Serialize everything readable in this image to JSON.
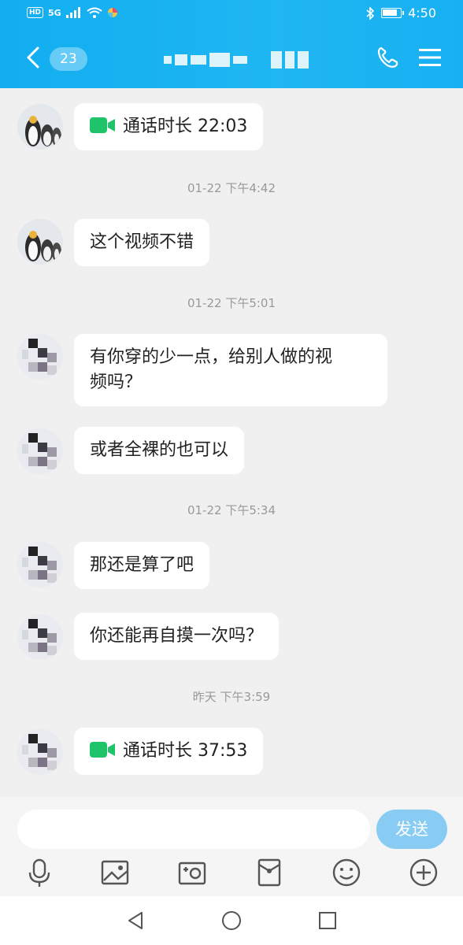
{
  "status_bar": {
    "hd_label": "HD",
    "network_label": "5G",
    "time": "4:50"
  },
  "header": {
    "unread_count": "23"
  },
  "timestamps": [
    "01-22 下午4:42",
    "01-22 下午5:01",
    "01-22 下午5:34",
    "昨天 下午3:59"
  ],
  "messages": [
    {
      "text": "通话时长 22:03",
      "type": "call",
      "avatar": "penguin"
    },
    {
      "text": "这个视频不错",
      "type": "text",
      "avatar": "penguin"
    },
    {
      "text": "有你穿的少一点，给别人做的视\n频吗？",
      "type": "text",
      "avatar": "pixelated"
    },
    {
      "text": "或者全裸的也可以",
      "type": "text",
      "avatar": "pixelated"
    },
    {
      "text": "那还是算了吧",
      "type": "text",
      "avatar": "pixelated"
    },
    {
      "text": "你还能再自摸一次吗？",
      "type": "text",
      "avatar": "pixelated"
    },
    {
      "text": "通话时长 37:53",
      "type": "call",
      "avatar": "pixelated"
    }
  ],
  "input": {
    "placeholder": "",
    "send_label": "发送"
  },
  "toolbar": [
    "mic-icon",
    "image-icon",
    "camera-icon",
    "red-packet-icon",
    "emoji-icon",
    "plus-icon"
  ],
  "colors": {
    "header": "#1bb1f2",
    "call_icon": "#1fc46a",
    "send_button": "#89ccf3"
  }
}
